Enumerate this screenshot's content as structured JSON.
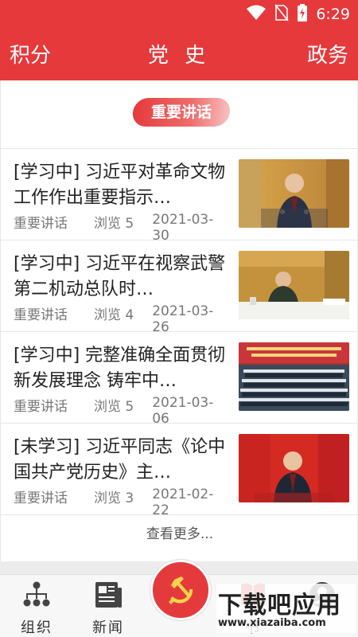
{
  "status_bar": {
    "time": "6:29"
  },
  "header": {
    "left_tab": "积分",
    "title": "党 史",
    "right_tab": "政务"
  },
  "section": {
    "badge": "重要讲话"
  },
  "news": [
    {
      "title": "[学习中] 习近平对革命文物工作作出重要指示…",
      "category": "重要讲话",
      "views": "浏览 5",
      "date": "2021-03-30"
    },
    {
      "title": "[学习中] 习近平在视察武警第二机动总队时…",
      "category": "重要讲话",
      "views": "浏览 4",
      "date": "2021-03-26"
    },
    {
      "title": "[学习中] 完整准确全面贯彻新发展理念 铸牢中…",
      "category": "重要讲话",
      "views": "浏览 5",
      "date": "2021-03-06"
    },
    {
      "title": "[未学习] 习近平同志《论中国共产党历史》主…",
      "category": "重要讲话",
      "views": "浏览 3",
      "date": "2021-02-22"
    }
  ],
  "more_link": "查看更多...",
  "tabbar": {
    "tab1": "组织",
    "tab2": "新闻",
    "tab4": "书",
    "tab5": ""
  },
  "watermark": {
    "main": "下载吧应用",
    "sub": "www.xiazaiba.com"
  },
  "colors": {
    "primary_red": "#e5393c",
    "text_dark": "#222222",
    "text_gray": "#777777"
  }
}
